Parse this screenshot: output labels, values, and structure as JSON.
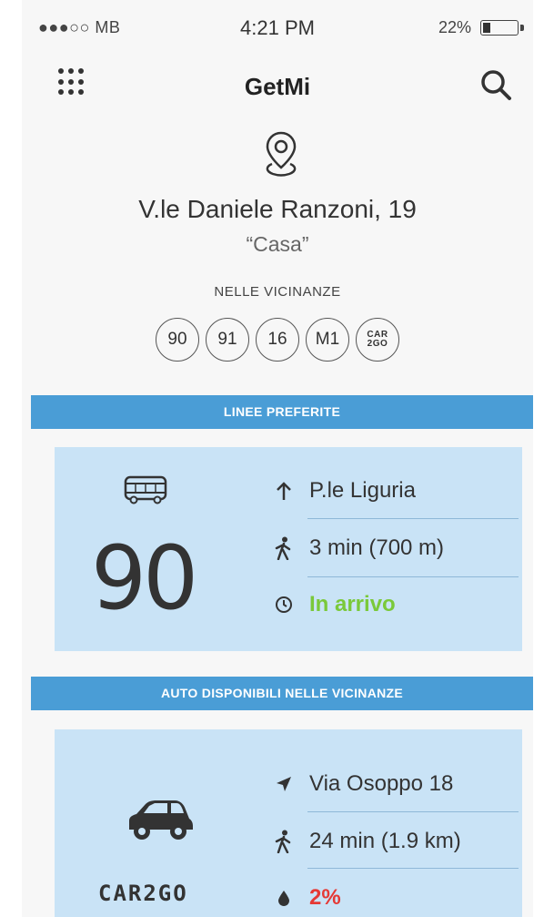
{
  "status_bar": {
    "carrier": "●●●○○ MB",
    "time": "4:21 PM",
    "battery_percent": "22%",
    "battery_level": 0.22
  },
  "nav": {
    "menu_icon": "grid-icon",
    "title": "GetMi",
    "search_icon": "search-icon"
  },
  "location": {
    "icon": "location-pin-icon",
    "address": "V.le Daniele Ranzoni, 19",
    "nickname": "“Casa”",
    "nearby_label": "NELLE VICINANZE",
    "nearby_lines": [
      "90",
      "91",
      "16",
      "M1"
    ],
    "nearby_car2go": [
      "CAR",
      "2GO"
    ]
  },
  "favorite_lines": {
    "header": "LINEE PREFERITE",
    "icon": "bus-icon",
    "line_number": "90",
    "direction": "P.le Liguria",
    "walk": "3 min (700 m)",
    "arrival": "In arrivo",
    "arrival_color": "#7ac93a"
  },
  "nearby_cars": {
    "header": "AUTO DISPONIBILI NELLE VICINANZE",
    "icon": "car-icon",
    "provider": "CAR2GO",
    "location": "Via Osoppo 18",
    "walk": "24 min (1.9 km)",
    "fuel": "2%",
    "fuel_color": "#e53935"
  },
  "colors": {
    "accent": "#4a9dd6",
    "card_background": "#c9e3f6"
  }
}
